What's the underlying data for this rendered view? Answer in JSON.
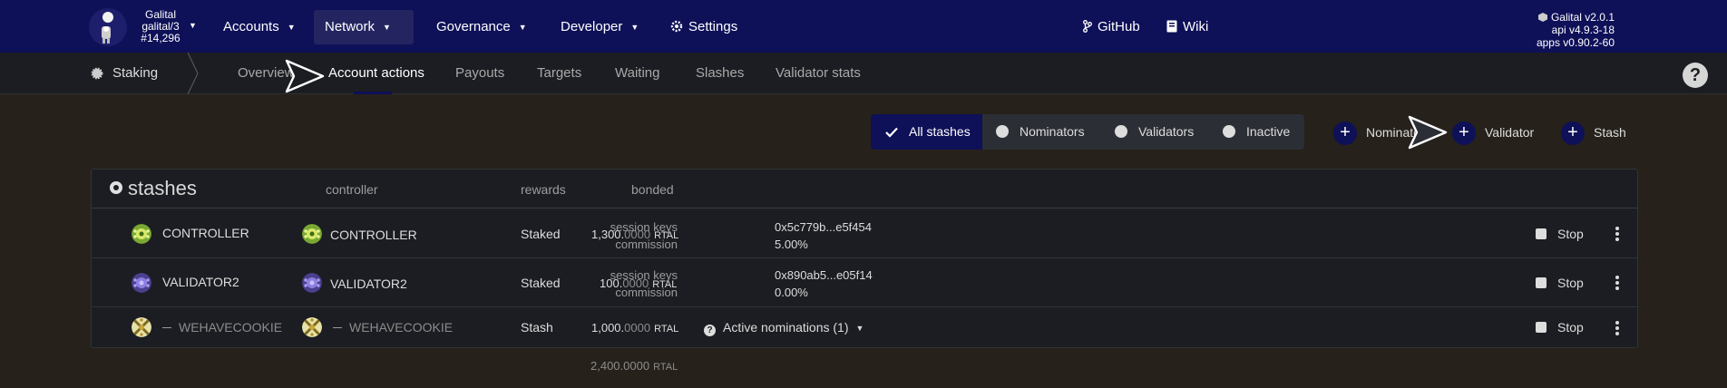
{
  "topbar": {
    "chain": {
      "name": "Galital",
      "account": "galital/3",
      "block": "#14,296"
    },
    "menu": [
      {
        "label": "Accounts"
      },
      {
        "label": "Network"
      },
      {
        "label": "Governance"
      },
      {
        "label": "Developer"
      },
      {
        "label": "Settings"
      }
    ],
    "links": [
      {
        "label": "GitHub"
      },
      {
        "label": "Wiki"
      }
    ],
    "versions": {
      "node": "Galital v2.0.1",
      "api": "api v4.9.3-18",
      "apps": "apps v0.90.2-60"
    }
  },
  "subnav": {
    "section": "Staking",
    "tabs": [
      {
        "label": "Overview"
      },
      {
        "label": "Account actions"
      },
      {
        "label": "Payouts"
      },
      {
        "label": "Targets"
      },
      {
        "label": "Waiting"
      },
      {
        "label": "Slashes"
      },
      {
        "label": "Validator stats"
      }
    ],
    "active_tab": "Account actions",
    "help": "?"
  },
  "filters": {
    "options": [
      {
        "label": "All stashes"
      },
      {
        "label": "Nominators"
      },
      {
        "label": "Validators"
      },
      {
        "label": "Inactive"
      }
    ],
    "selected": "All stashes"
  },
  "actions": [
    {
      "label": "Nominator"
    },
    {
      "label": "Validator"
    },
    {
      "label": "Stash"
    }
  ],
  "table": {
    "headers": {
      "stashes": "stashes",
      "controller": "controller",
      "rewards": "rewards",
      "bonded": "bonded"
    },
    "rows": [
      {
        "stash": "CONTROLLER",
        "controller": "CONTROLLER",
        "rewards": "Staked",
        "bonded_int": "1,300.",
        "bonded_frac": "0000",
        "unit": "RTAL",
        "k1": "session keys",
        "v1": "0x5c779b...e5f454",
        "k2": "commission",
        "v2": "5.00%",
        "stop": "Stop"
      },
      {
        "stash": "VALIDATOR2",
        "controller": "VALIDATOR2",
        "rewards": "Staked",
        "bonded_int": "100.",
        "bonded_frac": "0000",
        "unit": "RTAL",
        "k1": "session keys",
        "v1": "0x890ab5...e05f14",
        "k2": "commission",
        "v2": "0.00%",
        "stop": "Stop"
      },
      {
        "stash": "WEHAVECOOKIE",
        "controller": "WEHAVECOOKIE",
        "rewards": "Stash",
        "bonded_int": "1,000.",
        "bonded_frac": "0000",
        "unit": "RTAL",
        "nominations": "Active nominations (1)",
        "stop": "Stop"
      }
    ],
    "total": {
      "int": "2,400.",
      "frac": "0000",
      "unit": "RTAL"
    }
  },
  "colors": {
    "nav": "#0e1058",
    "background": "#26211b",
    "panel": "#1b1d22"
  }
}
